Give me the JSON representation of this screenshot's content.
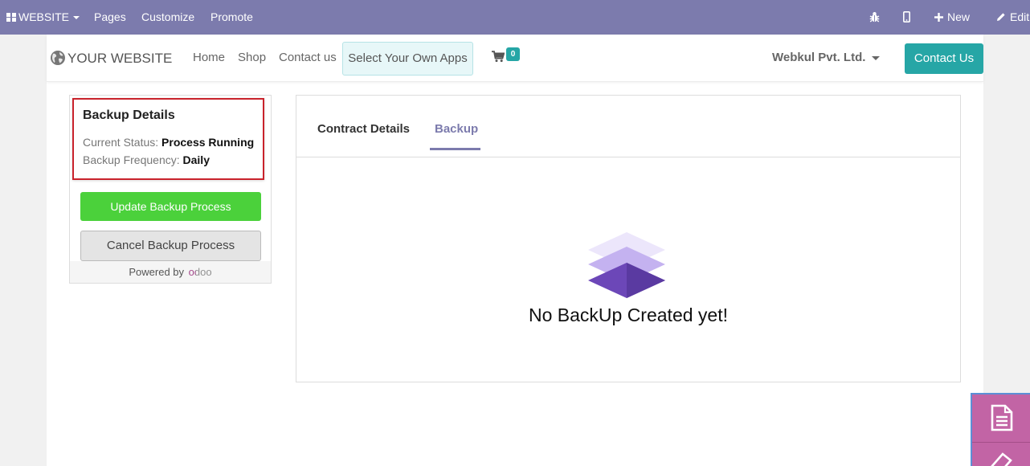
{
  "admin_bar": {
    "website_label": "WEBSITE",
    "pages": "Pages",
    "customize": "Customize",
    "promote": "Promote",
    "new": "New",
    "edit": "Edit"
  },
  "header": {
    "logo_text": "YOUR WEBSITE",
    "nav": [
      "Home",
      "Shop",
      "Contact us"
    ],
    "apps_button": "Select Your Own Apps",
    "cart_count": "0",
    "company": "Webkul Pvt. Ltd.",
    "contact_button": "Contact Us"
  },
  "backup_details": {
    "title": "Backup Details",
    "status_label": "Current Status:",
    "status_value": "Process Running",
    "frequency_label": "Backup Frequency:",
    "frequency_value": "Daily",
    "update_button": "Update Backup Process",
    "cancel_button": "Cancel Backup Process",
    "powered_by": "Powered by",
    "powered_brand": "odoo"
  },
  "tabs": {
    "items": [
      "Contract Details",
      "Backup"
    ],
    "active": "Backup"
  },
  "empty_state": {
    "message": "No BackUp Created yet!"
  },
  "colors": {
    "admin_bar": "#7c7bad",
    "accent_teal": "#26a6a6",
    "update_green": "#4bd13b",
    "highlight_red": "#c9232c",
    "widget_pink": "#c264a5"
  }
}
